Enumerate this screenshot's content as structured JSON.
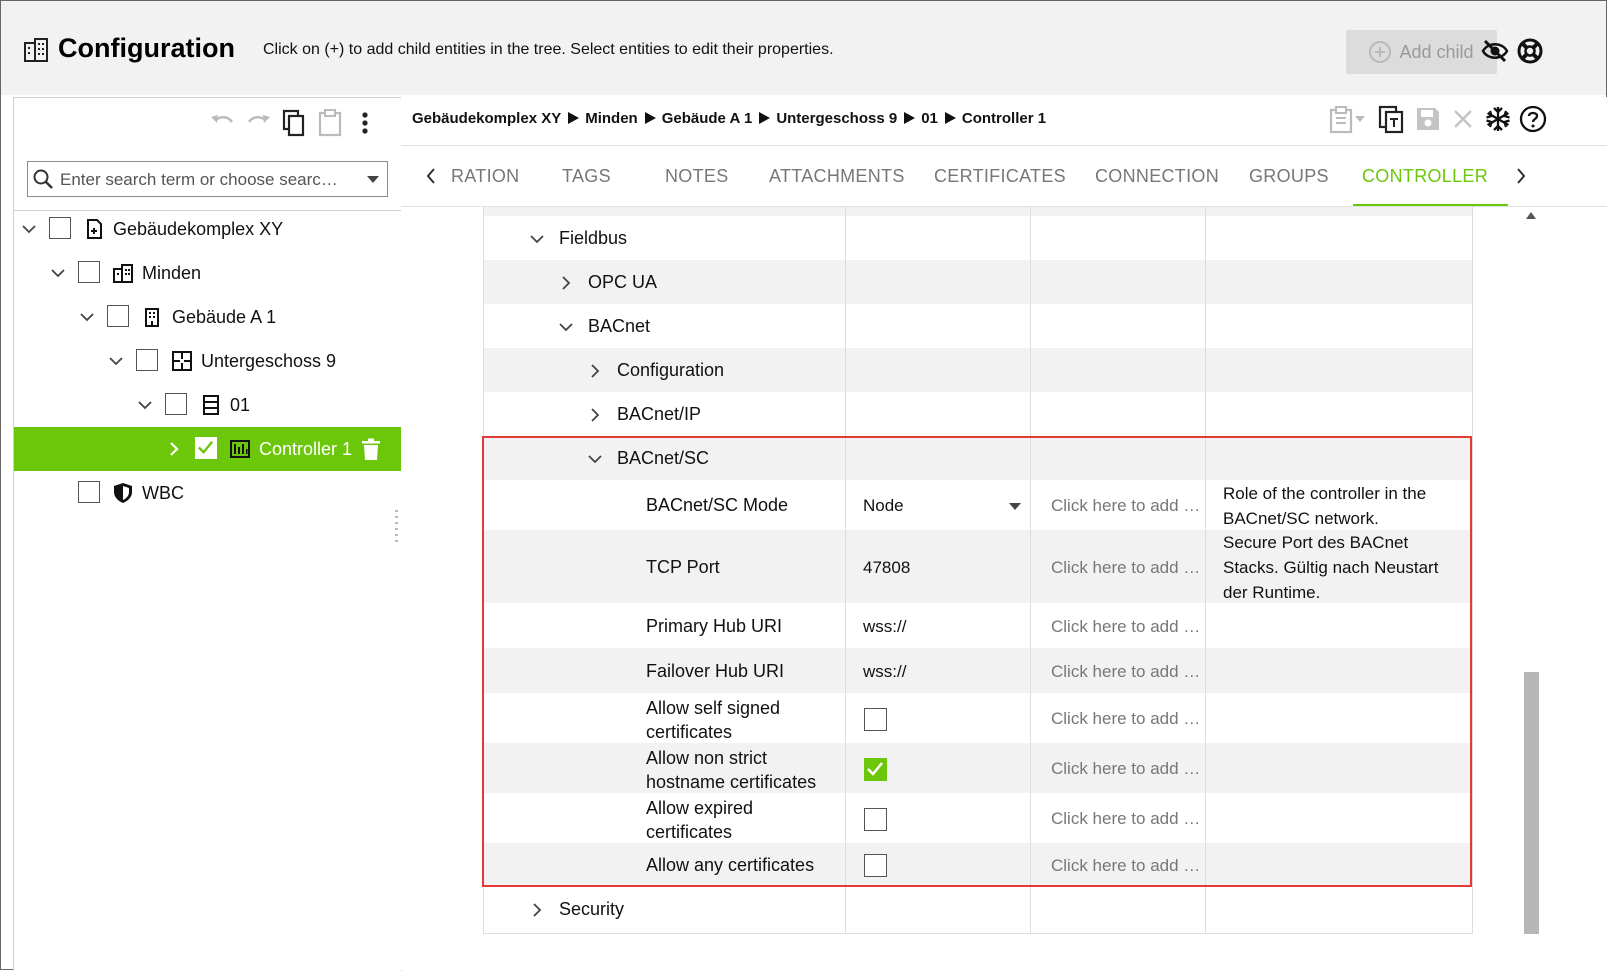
{
  "header": {
    "title": "Configuration",
    "hint": "Click on (+) to add child entities in the tree. Select entities to edit their properties.",
    "add_child_label": "Add child"
  },
  "left": {
    "search_placeholder": "Enter search term or choose searc…",
    "tree": [
      {
        "label": "Gebäudekomplex XY",
        "icon": "building-complex-icon",
        "expanded": true,
        "checked": false
      },
      {
        "label": "Minden",
        "icon": "city-icon",
        "expanded": true,
        "checked": false
      },
      {
        "label": "Gebäude A 1",
        "icon": "building-icon",
        "expanded": true,
        "checked": false
      },
      {
        "label": "Untergeschoss 9",
        "icon": "floor-plan-icon",
        "expanded": true,
        "checked": false
      },
      {
        "label": "01",
        "icon": "cabinet-icon",
        "expanded": true,
        "checked": false
      },
      {
        "label": "Controller 1",
        "icon": "controller-icon",
        "expanded": false,
        "checked": true,
        "selected": true
      },
      {
        "label": "WBC",
        "icon": "shield-icon",
        "checked": false
      }
    ]
  },
  "breadcrumb": [
    "Gebäudekomplex XY",
    "Minden",
    "Gebäude A 1",
    "Untergeschoss 9",
    "01",
    "Controller 1"
  ],
  "tabs": [
    {
      "label": "RATION"
    },
    {
      "label": "TAGS"
    },
    {
      "label": "NOTES"
    },
    {
      "label": "ATTACHMENTS"
    },
    {
      "label": "CERTIFICATES"
    },
    {
      "label": "CONNECTION"
    },
    {
      "label": "GROUPS"
    },
    {
      "label": "CONTROLLER",
      "active": true
    }
  ],
  "grid": {
    "rows": [
      {
        "label": "Fieldbus",
        "type": "group",
        "expanded": true
      },
      {
        "label": "OPC UA",
        "type": "group",
        "expanded": false
      },
      {
        "label": "BACnet",
        "type": "group",
        "expanded": true
      },
      {
        "label": "Configuration",
        "type": "group",
        "expanded": false
      },
      {
        "label": "BACnet/IP",
        "type": "group",
        "expanded": false
      },
      {
        "label": "BACnet/SC",
        "type": "group",
        "expanded": true
      },
      {
        "label": "BACnet/SC Mode",
        "value": "Node",
        "add": "Click here to add …",
        "description": "Role of the controller in the BACnet/SC network."
      },
      {
        "label": "TCP Port",
        "value": "47808",
        "add": "Click here to add …",
        "description": "Secure Port des BACnet Stacks. Gültig nach Neustart der Runtime."
      },
      {
        "label": "Primary Hub URI",
        "value": "wss://",
        "add": "Click here to add …"
      },
      {
        "label": "Failover Hub URI",
        "value": "wss://",
        "add": "Click here to add …"
      },
      {
        "label": "Allow self signed certificates",
        "checked": false,
        "add": "Click here to add …"
      },
      {
        "label": "Allow non strict hostname certificates",
        "checked": true,
        "add": "Click here to add …"
      },
      {
        "label": "Allow expired certificates",
        "checked": false,
        "add": "Click here to add …"
      },
      {
        "label": "Allow any certificates",
        "checked": false,
        "add": "Click here to add …"
      },
      {
        "label": "Security",
        "type": "group",
        "expanded": false
      }
    ]
  },
  "colors": {
    "accent": "#6cc70b",
    "highlight_border": "#e53935"
  }
}
